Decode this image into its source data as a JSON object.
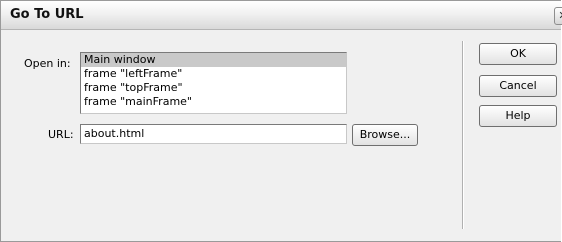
{
  "dialog": {
    "title": "Go To URL",
    "close_glyph": "✕"
  },
  "form": {
    "open_in_label": "Open in:",
    "frames": [
      "Main window",
      "frame \"leftFrame\"",
      "frame \"topFrame\"",
      "frame \"mainFrame\""
    ],
    "selected_frame": "Main window",
    "url_label": "URL:",
    "url_value": "about.html",
    "browse_label": "Browse..."
  },
  "buttons": {
    "ok": "OK",
    "cancel": "Cancel",
    "help": "Help"
  }
}
